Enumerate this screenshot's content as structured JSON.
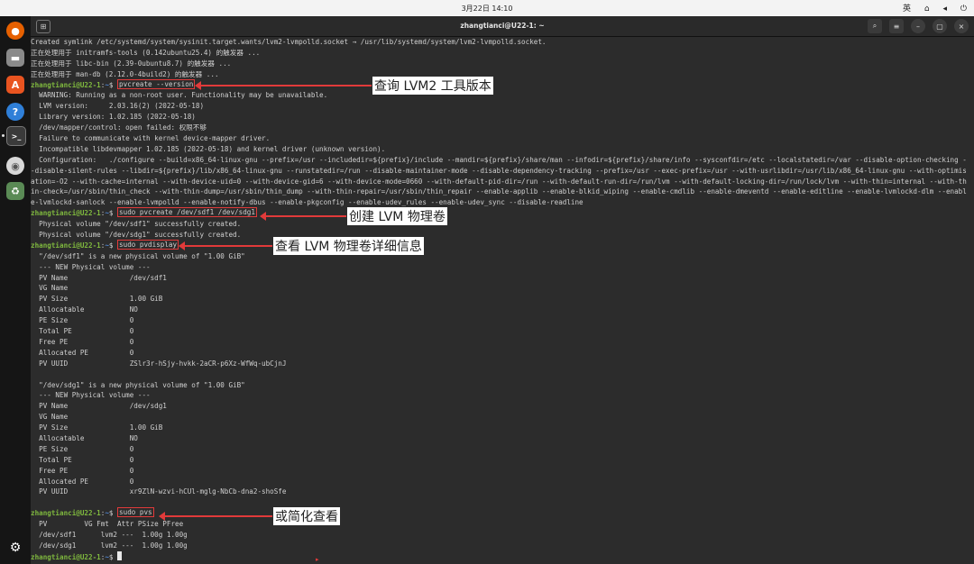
{
  "topbar": {
    "clock": "3月22日 14:10",
    "ime": "英",
    "network_icon": "network-icon",
    "volume_icon": "volume-icon",
    "power_icon": "power-icon"
  },
  "dock": {
    "items": [
      "firefox-icon",
      "files-icon",
      "app-center-icon",
      "help-icon",
      "terminal-icon",
      "disc-icon",
      "trash-icon",
      "ubuntu-apps-icon"
    ]
  },
  "window": {
    "title": "zhangtianci@U22-1: ~",
    "newtab_glyph": "⊞",
    "search_glyph": "⌕",
    "menu_glyph": "≡",
    "min_glyph": "–",
    "max_glyph": "▢",
    "close_glyph": "×"
  },
  "prompt": {
    "user": "zhangtianci@U22-1",
    "sep": ":",
    "path": "~",
    "sigil": "$ "
  },
  "terminal": {
    "pre": [
      "Created symlink /etc/systemd/system/sysinit.target.wants/lvm2-lvmpolld.socket → /usr/lib/systemd/system/lvm2-lvmpolld.socket.",
      "正在处理用于 initramfs-tools (0.142ubuntu25.4) 的触发器 ...",
      "正在处理用于 libc-bin (2.39-0ubuntu8.7) 的触发器 ...",
      "正在处理用于 man-db (2.12.0-4build2) 的触发器 ..."
    ],
    "cmd1": "pvcreate --version",
    "out1": [
      "  WARNING: Running as a non-root user. Functionality may be unavailable.",
      "  LVM version:     2.03.16(2) (2022-05-18)",
      "  Library version: 1.02.185 (2022-05-18)",
      "  /dev/mapper/control: open failed: 权限不够",
      "  Failure to communicate with kernel device-mapper driver.",
      "  Incompatible libdevmapper 1.02.185 (2022-05-18) and kernel driver (unknown version).",
      "  Configuration:   ./configure --build=x86_64-linux-gnu --prefix=/usr --includedir=${prefix}/include --mandir=${prefix}/share/man --infodir=${prefix}/share/info --sysconfdir=/etc --localstatedir=/var --disable-option-checking -",
      "-disable-silent-rules --libdir=${prefix}/lib/x86_64-linux-gnu --runstatedir=/run --disable-maintainer-mode --disable-dependency-tracking --prefix=/usr --exec-prefix=/usr --with-usrlibdir=/usr/lib/x86_64-linux-gnu --with-optimis",
      "ation=-O2 --with-cache=internal --with-device-uid=0 --with-device-gid=6 --with-device-mode=0660 --with-default-pid-dir=/run --with-default-run-dir=/run/lvm --with-default-locking-dir=/run/lock/lvm --with-thin=internal --with-th",
      "in-check=/usr/sbin/thin_check --with-thin-dump=/usr/sbin/thin_dump --with-thin-repair=/usr/sbin/thin_repair --enable-applib --enable-blkid_wiping --enable-cmdlib --enable-dmeventd --enable-editline --enable-lvmlockd-dlm --enabl",
      "e-lvmlockd-sanlock --enable-lvmpolld --enable-notify-dbus --enable-pkgconfig --enable-udev_rules --enable-udev_sync --disable-readline"
    ],
    "cmd2": "sudo pvcreate /dev/sdf1 /dev/sdg1",
    "out2": [
      "  Physical volume \"/dev/sdf1\" successfully created.",
      "  Physical volume \"/dev/sdg1\" successfully created."
    ],
    "cmd3": "sudo pvdisplay",
    "out3": [
      "  \"/dev/sdf1\" is a new physical volume of \"1.00 GiB\"",
      "  --- NEW Physical volume ---",
      "  PV Name               /dev/sdf1",
      "  VG Name",
      "  PV Size               1.00 GiB",
      "  Allocatable           NO",
      "  PE Size               0",
      "  Total PE              0",
      "  Free PE               0",
      "  Allocated PE          0",
      "  PV UUID               ZSlr3r-hSjy-hvkk-2aCR-p6Xz-WfWq-ubCjnJ",
      "",
      "  \"/dev/sdg1\" is a new physical volume of \"1.00 GiB\"",
      "  --- NEW Physical volume ---",
      "  PV Name               /dev/sdg1",
      "  VG Name",
      "  PV Size               1.00 GiB",
      "  Allocatable           NO",
      "  PE Size               0",
      "  Total PE              0",
      "  Free PE               0",
      "  Allocated PE          0",
      "  PV UUID               xr9ZlN-wzvi-hCUl-mglg-NbCb-dna2-shoSfe",
      ""
    ],
    "cmd4": "sudo pvs",
    "out4": [
      "  PV         VG Fmt  Attr PSize PFree",
      "  /dev/sdf1      lvm2 ---  1.00g 1.00g",
      "  /dev/sdg1      lvm2 ---  1.00g 1.00g"
    ]
  },
  "annotations": {
    "a1": "查询 LVM2 工具版本",
    "a2": "创建 LVM 物理卷",
    "a3": "查看 LVM 物理卷详细信息",
    "a4": "或简化查看"
  },
  "colors": {
    "prompt_green": "#7fb93e",
    "path_blue": "#4f86d3",
    "highlight_red": "#e23a3a",
    "terminal_bg": "#2c2c2c"
  }
}
